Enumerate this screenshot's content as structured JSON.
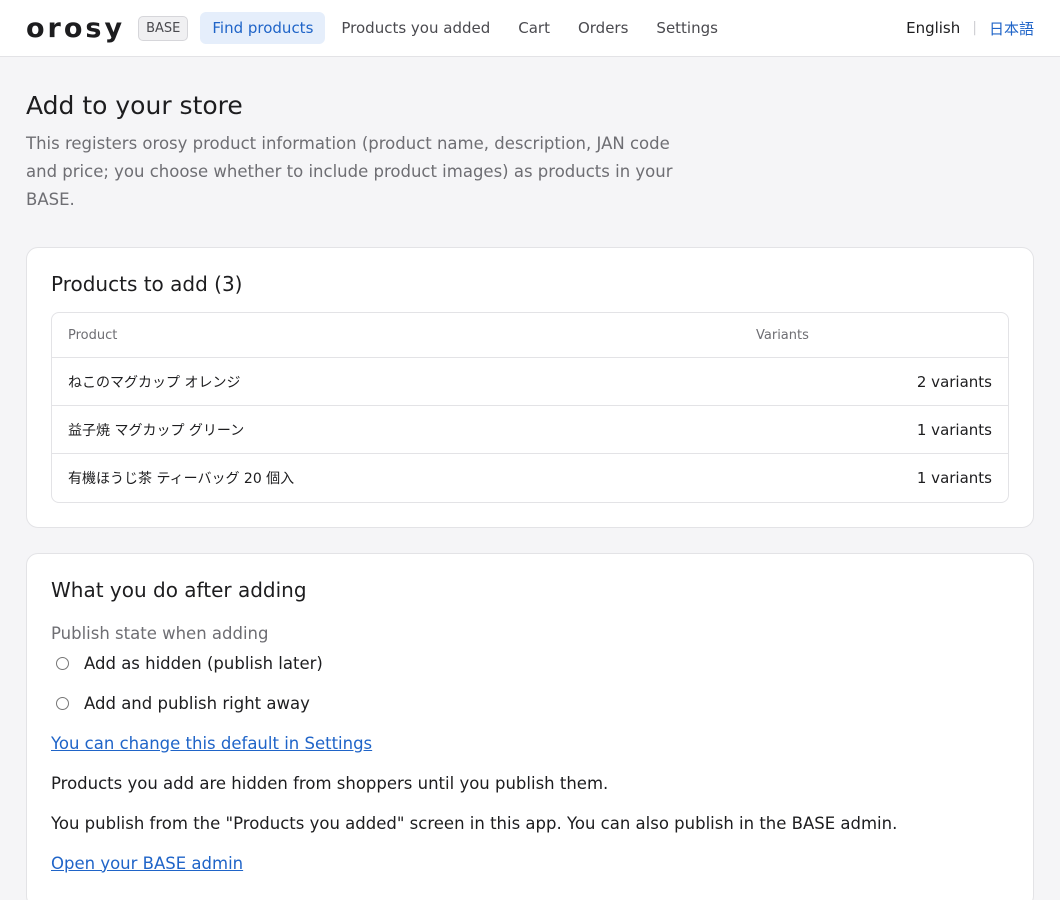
{
  "header": {
    "logo": "orosy",
    "badge": "BASE",
    "nav": [
      {
        "label": "Find products",
        "active": true
      },
      {
        "label": "Products you added"
      },
      {
        "label": "Cart"
      },
      {
        "label": "Orders"
      },
      {
        "label": "Settings"
      }
    ],
    "lang_current": "English",
    "lang_other": "日本語"
  },
  "page": {
    "title": "Add to your store",
    "description": "This registers orosy product information (product name, description, JAN code and price; you choose whether to include product images) as products in your BASE."
  },
  "products_card": {
    "title": "Products to add (3)",
    "col_product": "Product",
    "col_variants": "Variants",
    "rows": [
      {
        "name": "ねこのマグカップ オレンジ",
        "variants": "2 variants"
      },
      {
        "name": "益子焼 マグカップ グリーン",
        "variants": "1 variants"
      },
      {
        "name": "有機ほうじ茶 ティーバッグ 20 個入",
        "variants": "1 variants"
      }
    ]
  },
  "after_card": {
    "title": "What you do after adding",
    "publish_label": "Publish state when adding",
    "options": [
      {
        "label": "Add as hidden (publish later)",
        "selected": false
      },
      {
        "label": "Add and publish right away",
        "selected": false
      }
    ],
    "settings_link": "You can change this default in Settings",
    "note1": "Products you add are hidden from shoppers until you publish them.",
    "note2": "You publish from the \"Products you added\" screen in this app. You can also publish in the BASE admin.",
    "admin_link": "Open your BASE admin"
  },
  "colors": {
    "accent": "#1f64c8",
    "active_nav_bg": "#e5eefb",
    "page_bg": "#f5f5f7"
  }
}
